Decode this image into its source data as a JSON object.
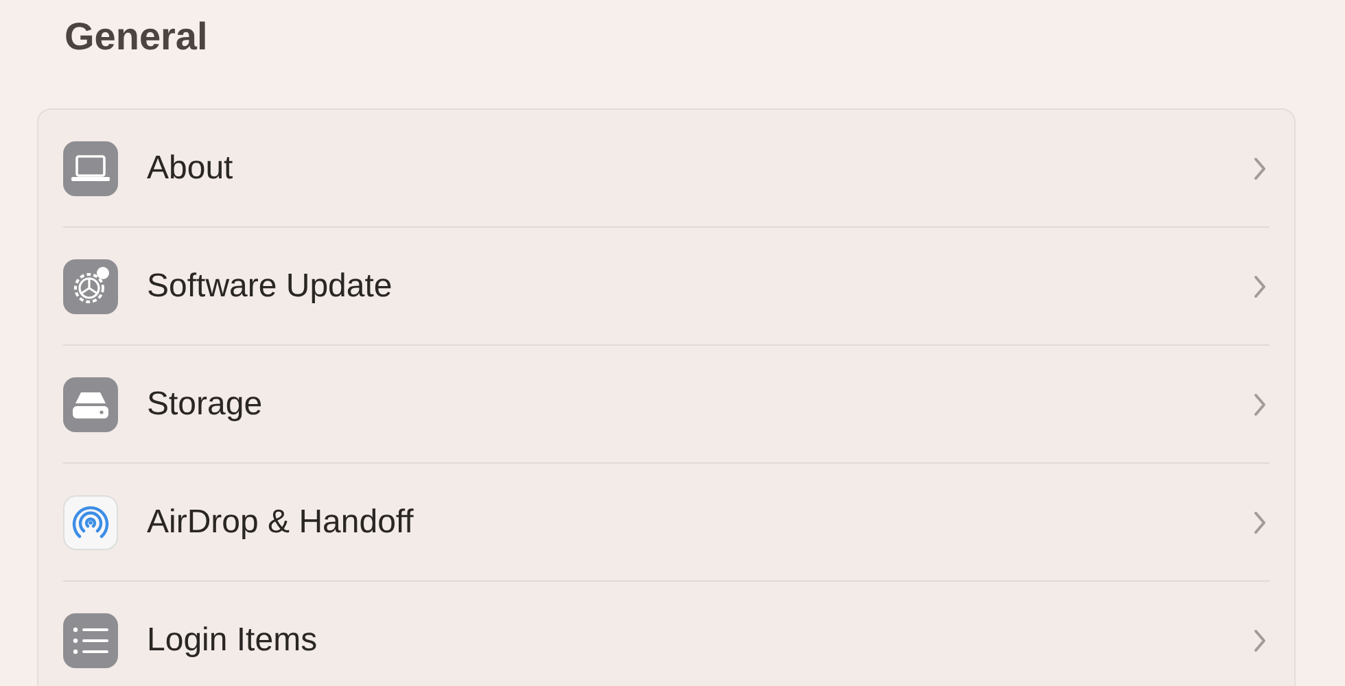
{
  "title": "General",
  "items": [
    {
      "kind": "laptop",
      "label": "About"
    },
    {
      "kind": "gear",
      "label": "Software Update"
    },
    {
      "kind": "drive",
      "label": "Storage"
    },
    {
      "kind": "airdrop",
      "label": "AirDrop & Handoff"
    },
    {
      "kind": "list",
      "label": "Login Items"
    }
  ]
}
